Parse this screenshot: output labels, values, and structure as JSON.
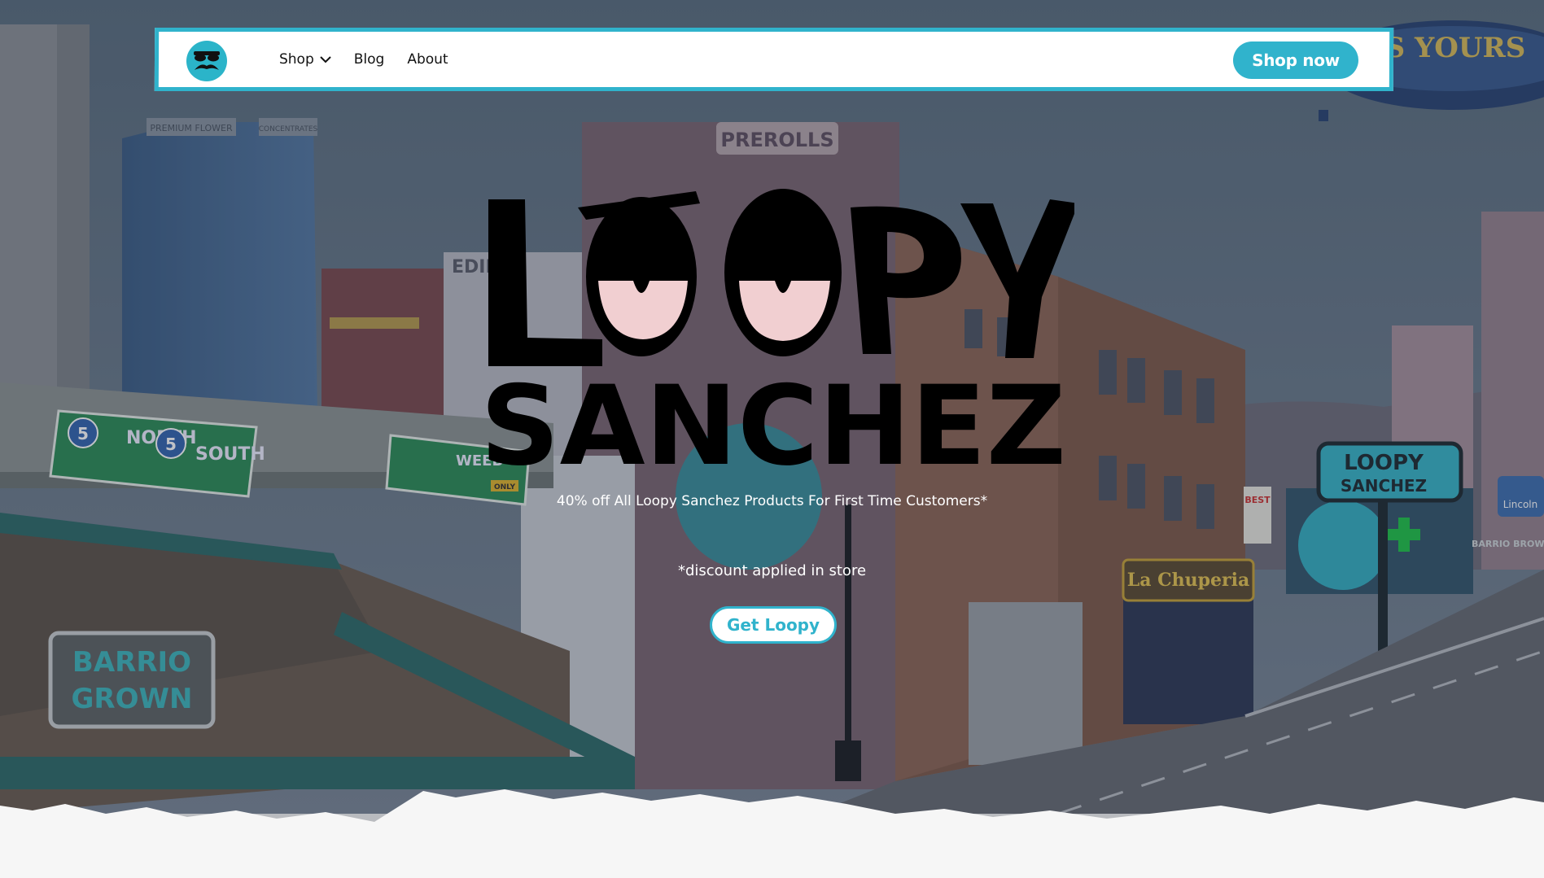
{
  "nav": {
    "logo_icon": "loopy-mustache-logo-icon",
    "items": [
      {
        "label": "Shop",
        "has_dropdown": true
      },
      {
        "label": "Blog"
      },
      {
        "label": "About"
      }
    ],
    "cta_label": "Shop now"
  },
  "hero": {
    "title_line1": "LOOPY",
    "title_line2": "SANCHEZ",
    "tagline": "40% off All Loopy Sanchez Products For First Time Customers*",
    "disclaimer": "*discount applied in store",
    "cta_label": "Get Loopy"
  },
  "scene": {
    "signs": {
      "north": "NORTH",
      "south": "SOUTH",
      "freeway_number": "5",
      "weed": "WEED",
      "only": "ONLY",
      "barrio_line1": "BARRIO",
      "barrio_line2": "GROWN",
      "prerolls": "PREROLLS",
      "edibles": "EDIBL",
      "premium": "PREMIUM FLOWER",
      "concentrates": "CONCENTRATES",
      "la_chuperia": "La Chuperia",
      "best": "BEST",
      "lincoln": "Lincoln",
      "barrio_brown": "BARRIO BROWN",
      "blimp": "IS YOURS",
      "pole_sign_line1": "LOOPY",
      "pole_sign_line2": "SANCHEZ"
    }
  },
  "colors": {
    "accent": "#30b3cc",
    "eye_pink": "#f1cfd1",
    "ink": "#000000",
    "page_bg": "#f6f6f6"
  }
}
